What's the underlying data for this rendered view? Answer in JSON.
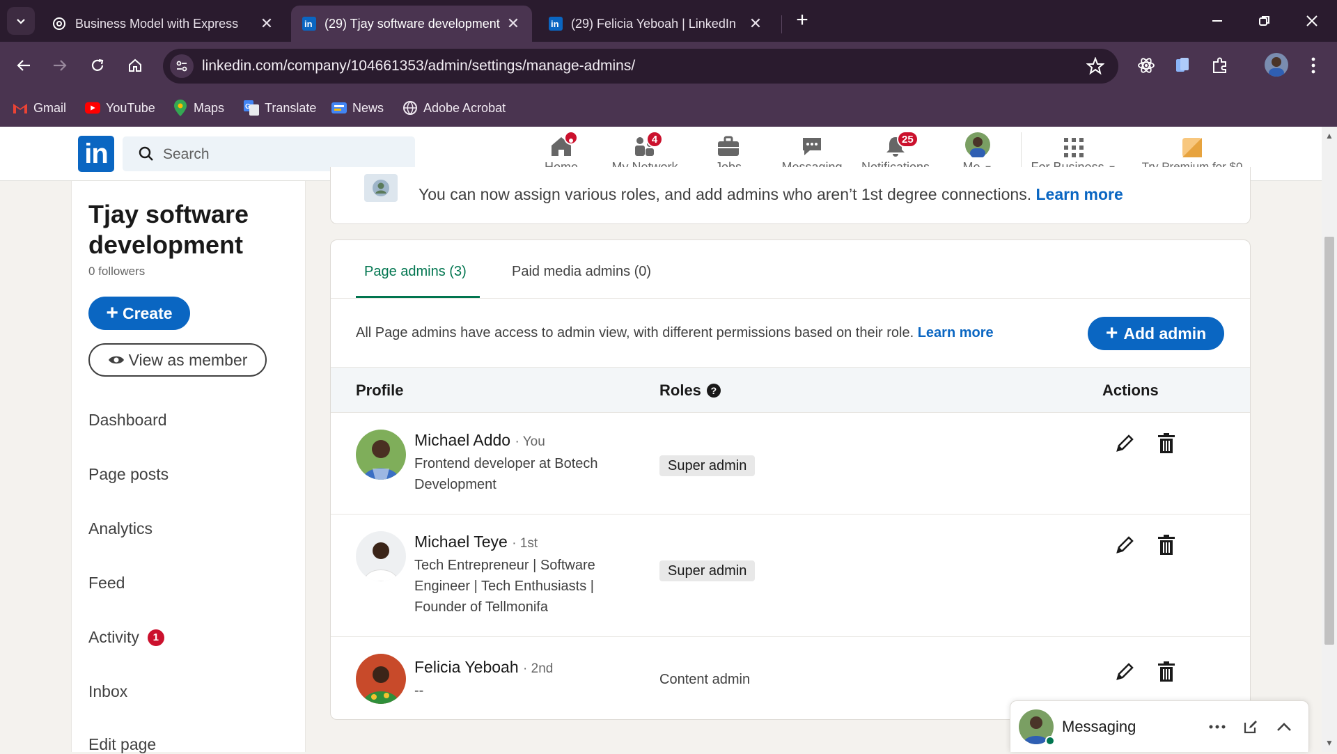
{
  "browser": {
    "tabs": [
      {
        "title": "Business Model with Express",
        "icon": "openai-icon",
        "active": false
      },
      {
        "title": "(29) Tjay software development",
        "icon": "linkedin-icon",
        "active": true
      },
      {
        "title": "(29) Felicia Yeboah | LinkedIn",
        "icon": "linkedin-icon",
        "active": false
      }
    ],
    "new_tab": "+",
    "url": "linkedin.com/company/104661353/admin/settings/manage-admins/",
    "bookmarks": [
      {
        "label": "Gmail",
        "icon": "gmail-icon"
      },
      {
        "label": "YouTube",
        "icon": "youtube-icon"
      },
      {
        "label": "Maps",
        "icon": "maps-icon"
      },
      {
        "label": "Translate",
        "icon": "translate-icon"
      },
      {
        "label": "News",
        "icon": "news-icon"
      },
      {
        "label": "Adobe Acrobat",
        "icon": "globe-icon"
      }
    ]
  },
  "linkedin_nav": {
    "logo": "in",
    "search_placeholder": "Search",
    "items": [
      {
        "label": "Home",
        "icon": "home-icon",
        "badge": ""
      },
      {
        "label": "My Network",
        "icon": "network-icon",
        "badge": "4"
      },
      {
        "label": "Jobs",
        "icon": "briefcase-icon",
        "badge": ""
      },
      {
        "label": "Messaging",
        "icon": "chat-icon",
        "badge": ""
      },
      {
        "label": "Notifications",
        "icon": "bell-icon",
        "badge": "25"
      },
      {
        "label": "Me",
        "icon": "avatar",
        "badge": ""
      }
    ],
    "for_business": "For Business",
    "premium": "Try Premium for $0"
  },
  "sidebar": {
    "company_name": "Tjay software development",
    "followers": "0 followers",
    "create_label": "Create",
    "view_as_member_label": "View as member",
    "items": [
      {
        "label": "Dashboard",
        "badge": ""
      },
      {
        "label": "Page posts",
        "badge": ""
      },
      {
        "label": "Analytics",
        "badge": ""
      },
      {
        "label": "Feed",
        "badge": ""
      },
      {
        "label": "Activity",
        "badge": "1"
      },
      {
        "label": "Inbox",
        "badge": ""
      },
      {
        "label": "Edit page",
        "badge": ""
      }
    ]
  },
  "notice": {
    "text": "You can now assign various roles, and add admins who aren’t 1st degree connections.",
    "link": "Learn more"
  },
  "admins": {
    "tabs": [
      "Page admins (3)",
      "Paid media admins (0)"
    ],
    "info_text": "All Page admins have access to admin view, with different permissions based on their role.",
    "info_link": "Learn more",
    "add_admin_label": "Add admin",
    "columns": {
      "profile": "Profile",
      "roles": "Roles",
      "actions": "Actions"
    },
    "rows": [
      {
        "name": "Michael Addo",
        "degree": "· You",
        "headline": "Frontend developer at Botech Development",
        "role": "Super admin"
      },
      {
        "name": "Michael Teye",
        "degree": "· 1st",
        "headline": "Tech Entrepreneur | Software Engineer | Tech Enthusiasts | Founder of Tellmonifa",
        "role": "Super admin"
      },
      {
        "name": "Felicia Yeboah",
        "degree": "· 2nd",
        "headline": "--",
        "role": "Content admin"
      }
    ]
  },
  "messaging": {
    "label": "Messaging"
  }
}
